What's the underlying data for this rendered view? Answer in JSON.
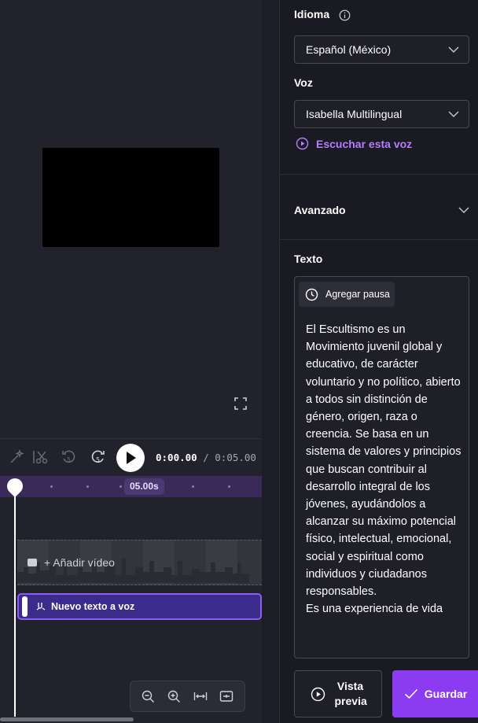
{
  "player": {
    "current_time": "0:00.00",
    "total_time": "/ 0:05.00"
  },
  "timeline": {
    "ruler_label": "05.00s",
    "add_video_label": "+ Añadir vídeo",
    "tts_clip_label": "Nuevo texto a voz"
  },
  "panel": {
    "language_label": "Idioma",
    "language_value": "Español (México)",
    "voice_label": "Voz",
    "voice_value": "Isabella Multilingual",
    "listen_link": "Escuchar esta voz",
    "advanced_label": "Avanzado",
    "text_label": "Texto",
    "add_pause_label": "Agregar pausa",
    "script": "El Escultismo es un Movimiento juvenil global y educativo, de carácter voluntario y no político, abierto a todos sin distinción de género, origen, raza o creencia. Se basa en un sistema de valores y principios que buscan contribuir al desarrollo integral de los jóvenes, ayudándolos a alcanzar su máximo potencial físico, intelectual, emocional, social y espiritual como individuos y ciudadanos responsables.\nEs una experiencia de vida",
    "preview_button": "Vista previa",
    "save_button": "Guardar"
  },
  "colors": {
    "accent": "#8b3cf0",
    "link": "#b57cff",
    "tts_clip": "#3b2b8a",
    "ruler": "#3a2a5a"
  }
}
